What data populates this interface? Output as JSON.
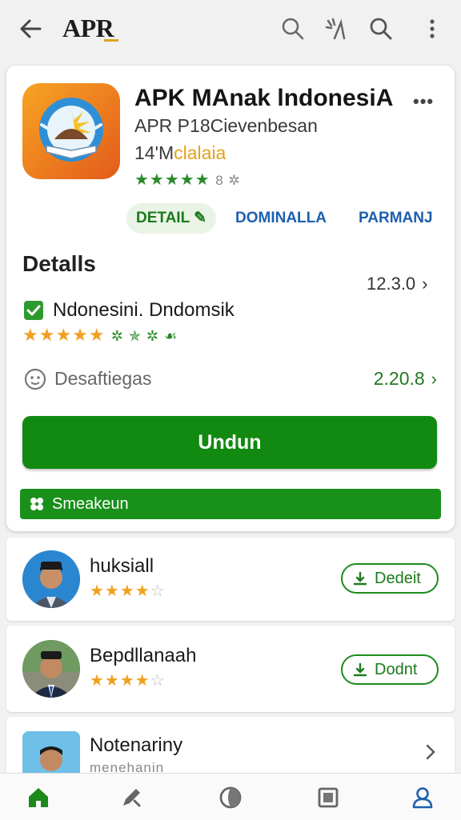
{
  "header": {
    "title": "APR",
    "icons": [
      "back-arrow-icon",
      "search-icon",
      "share-icon",
      "search-icon",
      "more-vert-icon"
    ]
  },
  "app": {
    "name": "APK MAnak lndonesiA",
    "developer": "APR P18Cievenbesan",
    "category_prefix": "14'M",
    "category_highlight": "clalaia",
    "rating_stars": "★★★★★",
    "rating_extra": "8 ✲"
  },
  "tabs": [
    "DETAIL",
    "DOMINALLA",
    "PARMANJ"
  ],
  "details": {
    "title": "Detalls",
    "version": "12.3.0",
    "feature_text": "Ndonesini. Dndomsik",
    "feature_rating": "★★★★★",
    "feature_extra": "✲ ✯ ✲ ☙",
    "secondary_label": "Desaftiegas",
    "secondary_value": "2.20.8"
  },
  "install_label": "Undun",
  "share_label": "Smeakeun",
  "list": [
    {
      "name": "huksiall",
      "stars": "★★★★",
      "empty": "☆",
      "button": "Dedeit"
    },
    {
      "name": "Bepdllanaah",
      "stars": "★★★★",
      "empty": "☆",
      "button": "Dodnt"
    },
    {
      "name": "Notenariny",
      "subtitle": "menehanin"
    }
  ],
  "bottom_nav": [
    "home-icon",
    "edit-icon",
    "discover-icon",
    "library-icon",
    "profile-icon"
  ],
  "colors": {
    "accent_green": "#128a12",
    "link_blue": "#1d5fb0",
    "star_orange": "#f0a020"
  }
}
